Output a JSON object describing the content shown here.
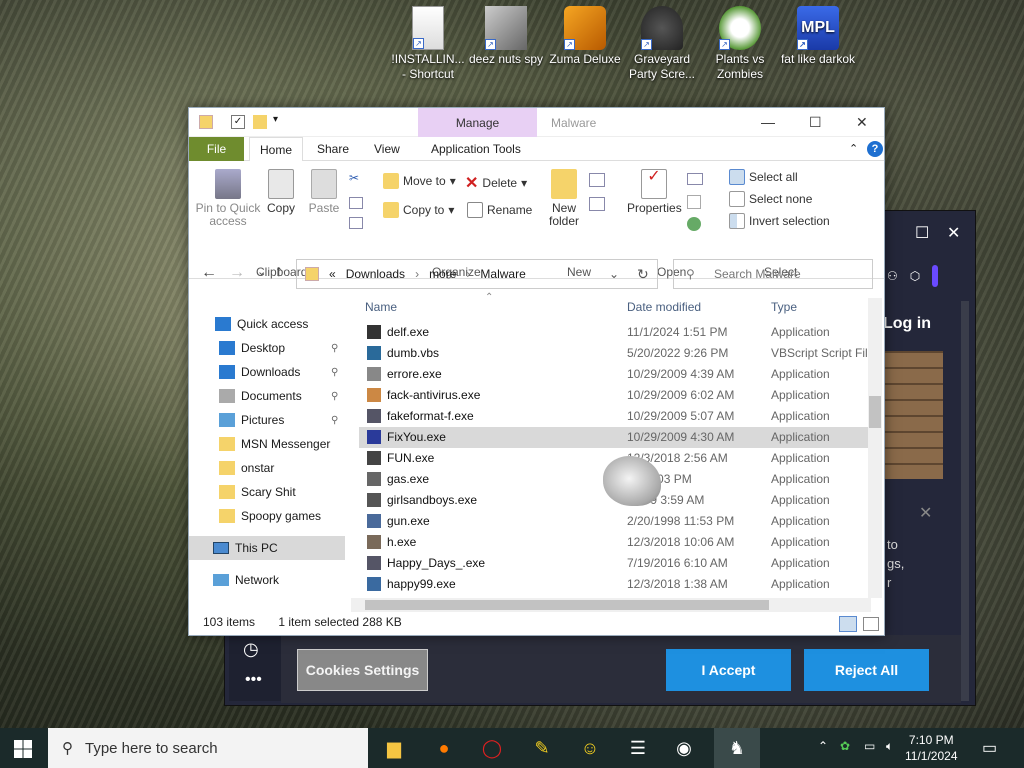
{
  "desktop": {
    "icons": [
      {
        "label": "!INSTALLIN... - Shortcut",
        "icon": "document-icon"
      },
      {
        "label": "deez nuts spy",
        "icon": "windows-stack-icon"
      },
      {
        "label": "Zuma Deluxe",
        "icon": "zuma-icon"
      },
      {
        "label": "Graveyard Party Scre...",
        "icon": "graveyard-icon"
      },
      {
        "label": "Plants vs Zombies",
        "icon": "flower-icon"
      },
      {
        "label": "fat like darkok",
        "icon": "mpl-logo-icon"
      }
    ]
  },
  "browser": {
    "login_label": "Log in",
    "cookie_settings": "Cookies Settings",
    "accept": "I Accept",
    "reject": "Reject All",
    "partial_text": [
      "to",
      "gs,",
      "r"
    ]
  },
  "explorer": {
    "title": "Malware",
    "manage_tab": "Manage",
    "tabs": [
      "File",
      "Home",
      "Share",
      "View",
      "Application Tools"
    ],
    "ribbon": {
      "clipboard": {
        "label": "Clipboard",
        "pin": "Pin to Quick access",
        "copy": "Copy",
        "paste": "Paste"
      },
      "organize": {
        "label": "Organize",
        "move_to": "Move to",
        "copy_to": "Copy to",
        "delete": "Delete",
        "rename": "Rename"
      },
      "new": {
        "label": "New",
        "new_folder": "New folder"
      },
      "open": {
        "label": "Open",
        "properties": "Properties"
      },
      "select": {
        "label": "Select",
        "select_all": "Select all",
        "select_none": "Select none",
        "invert": "Invert selection"
      }
    },
    "address": {
      "crumbs": [
        "Downloads",
        "more",
        "Malware"
      ],
      "prefix": "«"
    },
    "search_placeholder": "Search Malware",
    "nav": [
      {
        "label": "Quick access",
        "icon": "star-icon",
        "indent": false,
        "pinned": false
      },
      {
        "label": "Desktop",
        "icon": "desktop-icon",
        "indent": true,
        "pinned": true
      },
      {
        "label": "Downloads",
        "icon": "download-icon",
        "indent": true,
        "pinned": true
      },
      {
        "label": "Documents",
        "icon": "documents-icon",
        "indent": true,
        "pinned": true
      },
      {
        "label": "Pictures",
        "icon": "pictures-icon",
        "indent": true,
        "pinned": true
      },
      {
        "label": "MSN Messenger",
        "icon": "folder-icon",
        "indent": true,
        "pinned": false
      },
      {
        "label": "onstar",
        "icon": "folder-icon",
        "indent": true,
        "pinned": false
      },
      {
        "label": "Scary Shit",
        "icon": "folder-icon",
        "indent": true,
        "pinned": false
      },
      {
        "label": "Spoopy games",
        "icon": "folder-icon",
        "indent": true,
        "pinned": false
      }
    ],
    "this_pc": "This PC",
    "network": "Network",
    "columns": [
      "Name",
      "Date modified",
      "Type"
    ],
    "files": [
      {
        "name": "delf.exe",
        "date": "11/1/2024 1:51 PM",
        "type": "Application"
      },
      {
        "name": "dumb.vbs",
        "date": "5/20/2022 9:26 PM",
        "type": "VBScript Script File"
      },
      {
        "name": "errore.exe",
        "date": "10/29/2009 4:39 AM",
        "type": "Application"
      },
      {
        "name": "fack-antivirus.exe",
        "date": "10/29/2009 6:02 AM",
        "type": "Application"
      },
      {
        "name": "fakeformat-f.exe",
        "date": "10/29/2009 5:07 AM",
        "type": "Application"
      },
      {
        "name": "FixYou.exe",
        "date": "10/29/2009 4:30 AM",
        "type": "Application",
        "selected": true
      },
      {
        "name": "FUN.exe",
        "date": "12/3/2018 2:56 AM",
        "type": "Application"
      },
      {
        "name": "gas.exe",
        "date": "/24 8:03 PM",
        "type": "Application"
      },
      {
        "name": "girlsandboys.exe",
        "date": "/2009 3:59 AM",
        "type": "Application"
      },
      {
        "name": "gun.exe",
        "date": "2/20/1998 11:53 PM",
        "type": "Application"
      },
      {
        "name": "h.exe",
        "date": "12/3/2018 10:06 AM",
        "type": "Application"
      },
      {
        "name": "Happy_Days_.exe",
        "date": "7/19/2016 6:10 AM",
        "type": "Application"
      },
      {
        "name": "happy99.exe",
        "date": "12/3/2018 1:38 AM",
        "type": "Application"
      }
    ],
    "status": {
      "count": "103 items",
      "selected": "1 item selected  288 KB"
    }
  },
  "taskbar": {
    "search_placeholder": "Type here to search",
    "time": "7:10 PM",
    "date": "11/1/2024"
  },
  "colors": {
    "file_tab": "#6f8c2e",
    "manage": "#e8d0f4",
    "accent_blue": "#1e90e0",
    "selected_row": "#d9d9d9"
  }
}
